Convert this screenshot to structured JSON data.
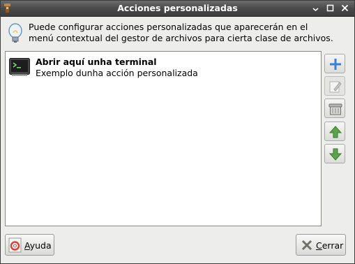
{
  "window": {
    "title": "Acciones personalizadas",
    "controls": {
      "minimize": "🗕",
      "maximize": "☐",
      "close": "✕"
    }
  },
  "info": {
    "line1": "Puede configurar acciones personalizadas que aparecerán en el",
    "line2": "menú contextual del gestor de archivos para cierta clase de archivos."
  },
  "actions": [
    {
      "name": "Abrir aquí unha terminal",
      "description": "Exemplo dunha acción personalizada",
      "icon": "terminal-icon"
    }
  ],
  "side_buttons": [
    {
      "name": "add",
      "icon": "plus-icon",
      "enabled": true
    },
    {
      "name": "edit",
      "icon": "edit-icon",
      "enabled": false
    },
    {
      "name": "delete",
      "icon": "delete-icon",
      "enabled": true
    },
    {
      "name": "move-up",
      "icon": "arrow-up-icon",
      "enabled": true
    },
    {
      "name": "move-down",
      "icon": "arrow-down-icon",
      "enabled": true
    }
  ],
  "footer": {
    "help": {
      "mnemonic": "A",
      "rest": "yuda",
      "icon": "help-lifebuoy-icon"
    },
    "close": {
      "mnemonic": "C",
      "rest": "errar",
      "icon": "close-x-icon"
    }
  },
  "colors": {
    "plus": "#3b7fd1",
    "arrows": "#5aa44a",
    "terminal_text": "#7cd97c"
  }
}
